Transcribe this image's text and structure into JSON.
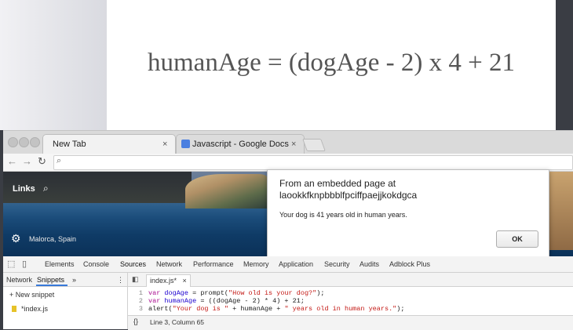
{
  "slide": {
    "formula": "humanAge = (dogAge - 2) x 4 + 21"
  },
  "browser": {
    "tabs": [
      {
        "label": "New Tab",
        "close": "×"
      },
      {
        "label": "Javascript - Google Docs",
        "close": "×"
      }
    ]
  },
  "page": {
    "links_label": "Links",
    "location": "Malorca, Spain"
  },
  "dialog": {
    "title": "From an embedded page at laookkfknpbbblfpciffpaejjkokdgca",
    "message": "Your dog is 41 years old in human years.",
    "ok_label": "OK"
  },
  "devtools": {
    "tabs": [
      "Elements",
      "Console",
      "Sources",
      "Network",
      "Performance",
      "Memory",
      "Application",
      "Security",
      "Audits",
      "Adblock Plus"
    ],
    "sidebar_tabs": [
      "Network",
      "Snippets",
      "»"
    ],
    "new_snippet": "+ New snippet",
    "file": "*index.js",
    "editor_tab": "index.js*",
    "editor_tab_close": "×",
    "line_numbers": [
      "1",
      "2",
      "3"
    ],
    "code": {
      "l1_kw": "var ",
      "l1_var": "dogAge",
      "l1_mid": " = prompt(",
      "l1_str": "\"How old is your dog?\"",
      "l1_end": ");",
      "l2_kw": "var ",
      "l2_var": "humanAge",
      "l2_rest": " = ((dogAge - 2) * 4) + 21;",
      "l3_a": "alert(",
      "l3_s1": "\"Your dog is \"",
      "l3_mid": " + humanAge + ",
      "l3_s2": "\" years old in human years.\"",
      "l3_end": ");"
    },
    "status": "Line 3, Column 65",
    "status_braces": "{}"
  }
}
